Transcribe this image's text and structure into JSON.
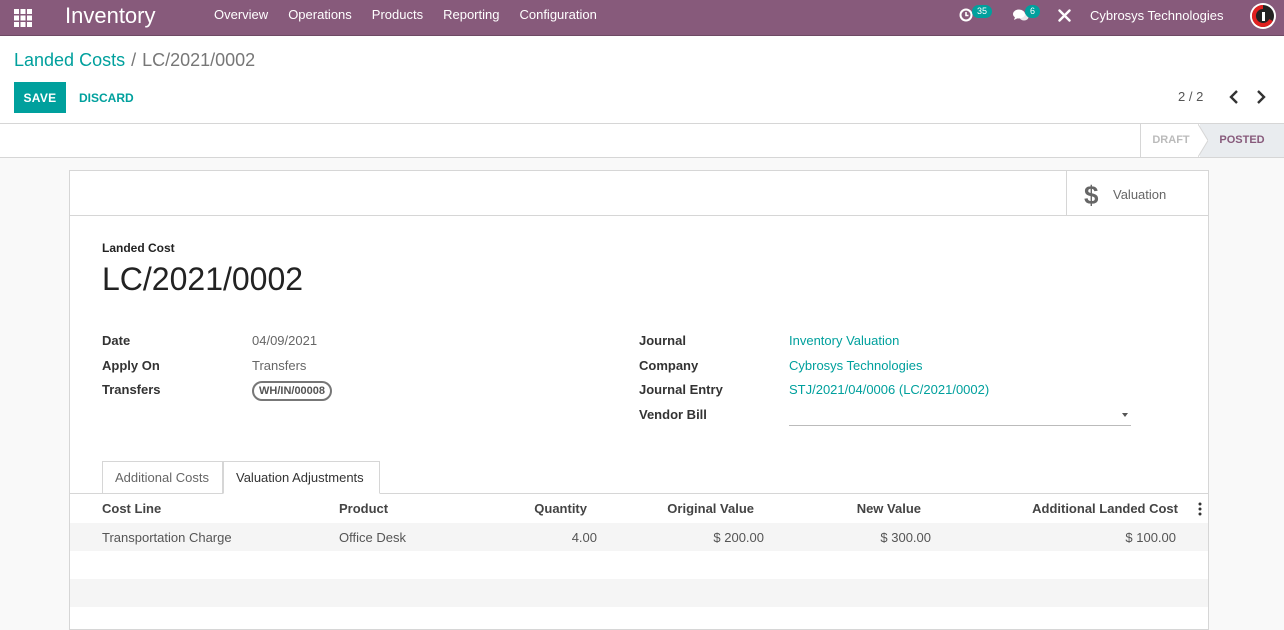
{
  "navbar": {
    "app_title": "Inventory",
    "menu": [
      "Overview",
      "Operations",
      "Products",
      "Reporting",
      "Configuration"
    ],
    "activity_count": "35",
    "messages_count": "6",
    "company": "Cybrosys Technologies",
    "brand_color": "#875a7b"
  },
  "control_panel": {
    "breadcrumb_parent": "Landed Costs",
    "breadcrumb_separator": "/",
    "breadcrumb_current": "LC/2021/0002",
    "save_label": "SAVE",
    "discard_label": "DISCARD",
    "pager": "2 / 2"
  },
  "statusbar": {
    "stages": [
      "DRAFT",
      "POSTED"
    ],
    "active_stage": "POSTED"
  },
  "sheet": {
    "valuation_button": "Valuation",
    "caption": "Landed Cost",
    "name": "LC/2021/0002",
    "left_fields": [
      {
        "label": "Date",
        "value": "04/09/2021"
      },
      {
        "label": "Apply On",
        "value": "Transfers"
      },
      {
        "label": "Transfers",
        "value": "WH/IN/00008"
      }
    ],
    "right_fields": [
      {
        "label": "Journal",
        "value": "Inventory Valuation"
      },
      {
        "label": "Company",
        "value": "Cybrosys Technologies"
      },
      {
        "label": "Journal Entry",
        "value": "STJ/2021/04/0006 (LC/2021/0002)"
      },
      {
        "label": "Vendor Bill",
        "value": ""
      }
    ],
    "tabs": [
      "Additional Costs",
      "Valuation Adjustments"
    ],
    "active_tab": "Valuation Adjustments",
    "table": {
      "columns": [
        "Cost Line",
        "Product",
        "Quantity",
        "Original Value",
        "New Value",
        "Additional Landed Cost"
      ],
      "rows": [
        [
          "Transportation Charge",
          "Office Desk",
          "4.00",
          "$ 200.00",
          "$ 300.00",
          "$ 100.00"
        ]
      ]
    },
    "accent_color": "#00a09d"
  }
}
